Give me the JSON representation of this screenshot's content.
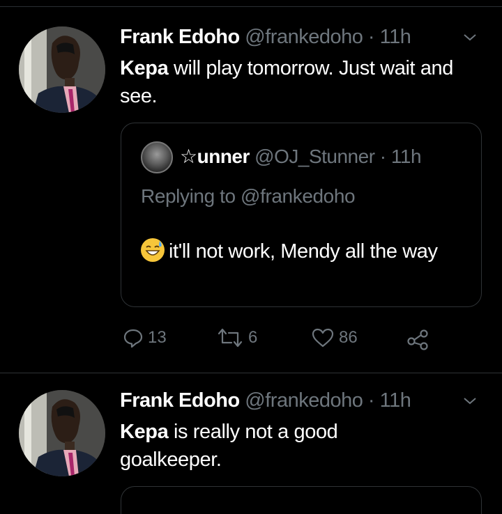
{
  "tweet1": {
    "author_name": "Frank Edoho",
    "handle": "@frankedoho",
    "separator": "·",
    "time": "11h",
    "text_bold": "Kepa",
    "text_rest": " will play tomorrow. Just wait and see.",
    "quote": {
      "author_prefix": "☆",
      "author_name": "unner",
      "handle": "@OJ_Stunner",
      "separator": "·",
      "time": "11h",
      "replying_to": "Replying to @frankedoho",
      "emoji": "grinning-face-with-sweat",
      "text": "it'll not work, Mendy all the way"
    },
    "actions": {
      "reply_count": "13",
      "retweet_count": "6",
      "like_count": "86"
    }
  },
  "tweet2": {
    "author_name": "Frank Edoho",
    "handle": "@frankedoho",
    "separator": "·",
    "time": "11h",
    "text_bold": "Kepa",
    "text_rest": " is really not a good goalkeeper."
  },
  "colors": {
    "background": "#000000",
    "muted": "#6e767d",
    "border": "#2f3336",
    "text": "#ffffff"
  }
}
